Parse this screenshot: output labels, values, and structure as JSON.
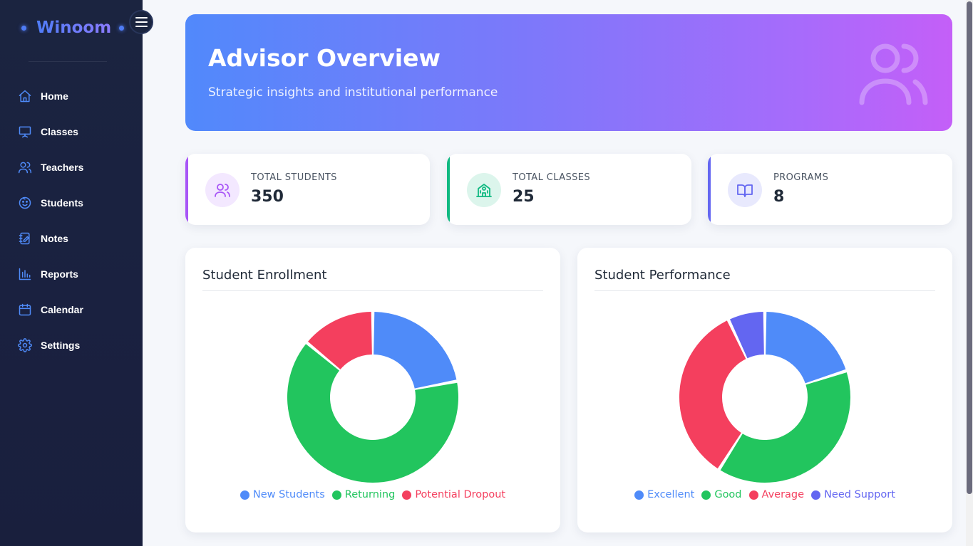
{
  "sidebar": {
    "brand": "Winoom",
    "items": [
      {
        "label": "Home",
        "icon": "home-icon"
      },
      {
        "label": "Classes",
        "icon": "presentation-icon"
      },
      {
        "label": "Teachers",
        "icon": "users-icon"
      },
      {
        "label": "Students",
        "icon": "smiley-icon"
      },
      {
        "label": "Notes",
        "icon": "notebook-icon"
      },
      {
        "label": "Reports",
        "icon": "bar-chart-icon"
      },
      {
        "label": "Calendar",
        "icon": "calendar-icon"
      },
      {
        "label": "Settings",
        "icon": "gear-icon"
      }
    ]
  },
  "hero": {
    "title": "Advisor Overview",
    "subtitle": "Strategic insights and institutional performance",
    "icon": "users-icon"
  },
  "stats": [
    {
      "label": "TOTAL STUDENTS",
      "value": "350",
      "icon": "users-icon",
      "color": "#a855f7"
    },
    {
      "label": "TOTAL CLASSES",
      "value": "25",
      "icon": "school-icon",
      "color": "#10b981"
    },
    {
      "label": "PROGRAMS",
      "value": "8",
      "icon": "book-open-icon",
      "color": "#6366f1"
    }
  ],
  "charts": {
    "enrollment_title": "Student Enrollment",
    "performance_title": "Student Performance"
  },
  "chart_data": [
    {
      "type": "pie",
      "title": "Student Enrollment",
      "categories": [
        "New Students",
        "Returning",
        "Potential Dropout"
      ],
      "values": [
        22,
        64,
        14
      ],
      "colors": [
        "#4f8bf9",
        "#22c55e",
        "#f43f5e"
      ],
      "legend": "bottom"
    },
    {
      "type": "pie",
      "title": "Student Performance",
      "categories": [
        "Excellent",
        "Good",
        "Average",
        "Need Support"
      ],
      "values": [
        20,
        39,
        34,
        7
      ],
      "colors": [
        "#4f8bf9",
        "#22c55e",
        "#f43f5e",
        "#6366f1"
      ],
      "legend": "bottom"
    }
  ]
}
